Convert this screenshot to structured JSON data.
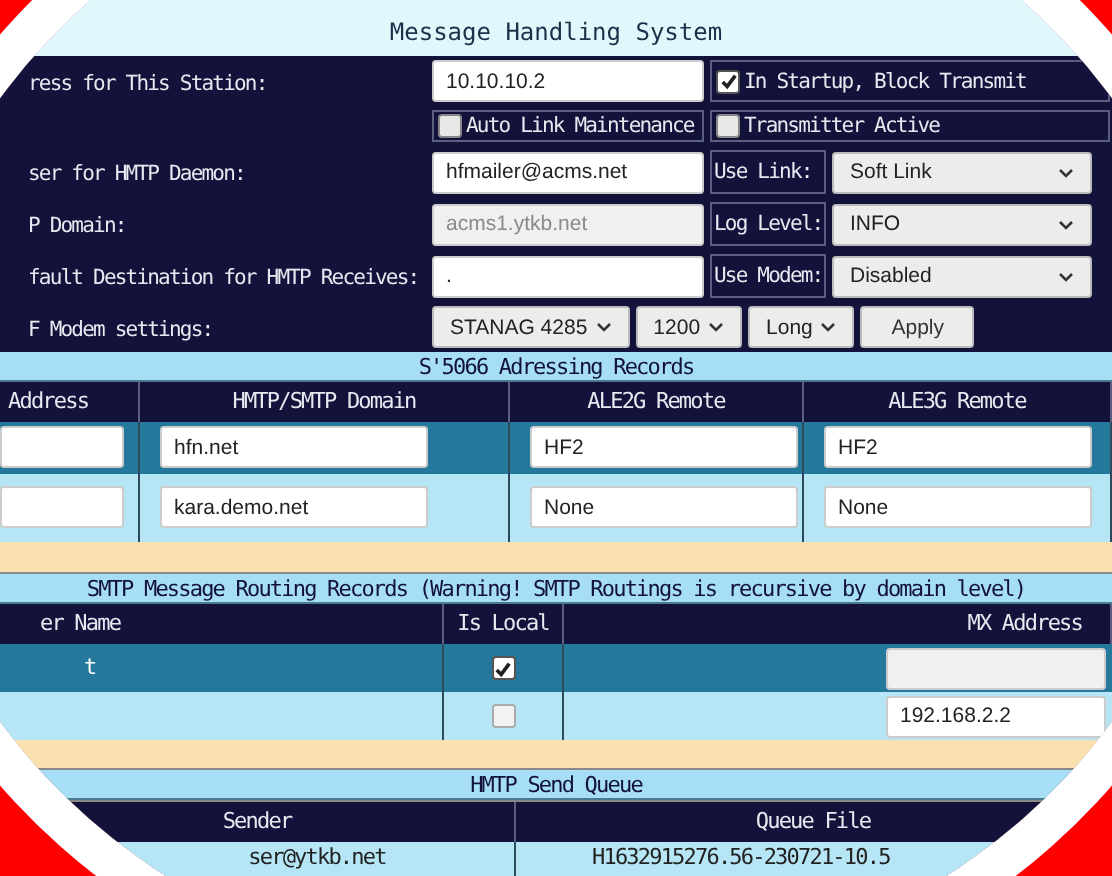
{
  "title": "Message Handling System",
  "settings": {
    "station_address": {
      "label": "ress for This Station:",
      "value": "10.10.10.2"
    },
    "block_transmit": {
      "label": "In Startup, Block Transmit",
      "checked": true
    },
    "auto_link": {
      "label": "Auto Link Maintenance",
      "checked": false
    },
    "transmitter_active": {
      "label": "Transmitter Active",
      "checked": false
    },
    "daemon_user": {
      "label": "ser for HMTP Daemon:",
      "value": "hfmailer@acms.net"
    },
    "use_link": {
      "label": "Use Link:",
      "value": "Soft Link"
    },
    "domain": {
      "label": "P Domain:",
      "value": "acms1.ytkb.net",
      "disabled": true
    },
    "log_level": {
      "label": "Log Level:",
      "value": "INFO"
    },
    "default_destination": {
      "label": "fault Destination for HMTP Receives:",
      "value": "."
    },
    "use_modem": {
      "label": "Use Modem:",
      "value": "Disabled"
    },
    "modem_settings": {
      "label": "F Modem settings:",
      "selects": [
        "STANAG 4285",
        "1200",
        "Long"
      ],
      "button": "Apply"
    }
  },
  "addressing": {
    "title": "S'5066 Adressing Records",
    "columns": [
      "Address",
      "HMTP/SMTP Domain",
      "ALE2G Remote",
      "ALE3G Remote"
    ],
    "rows": [
      {
        "highlighted": true,
        "domain": "hfn.net",
        "ale2g": "HF2",
        "ale3g": "HF2"
      },
      {
        "highlighted": false,
        "domain": "kara.demo.net",
        "ale2g": "None",
        "ale3g": "None"
      }
    ]
  },
  "routing": {
    "title": "SMTP Message Routing Records (Warning! SMTP Routings is recursive by domain level)",
    "columns": [
      "er Name",
      "Is Local",
      "MX Address"
    ],
    "rows": [
      {
        "highlighted": true,
        "name": "t",
        "is_local": true,
        "mx_disabled": true
      },
      {
        "highlighted": false,
        "is_local": false,
        "mx": "192.168.2.2",
        "mx_disabled": false
      }
    ]
  },
  "queue": {
    "title": "HMTP Send Queue",
    "columns": [
      "Sender",
      "Queue File"
    ],
    "rows": [
      {
        "sender": "ser@ytkb.net",
        "queue_file": "H1632915276.56-230721-10.5"
      }
    ]
  }
}
